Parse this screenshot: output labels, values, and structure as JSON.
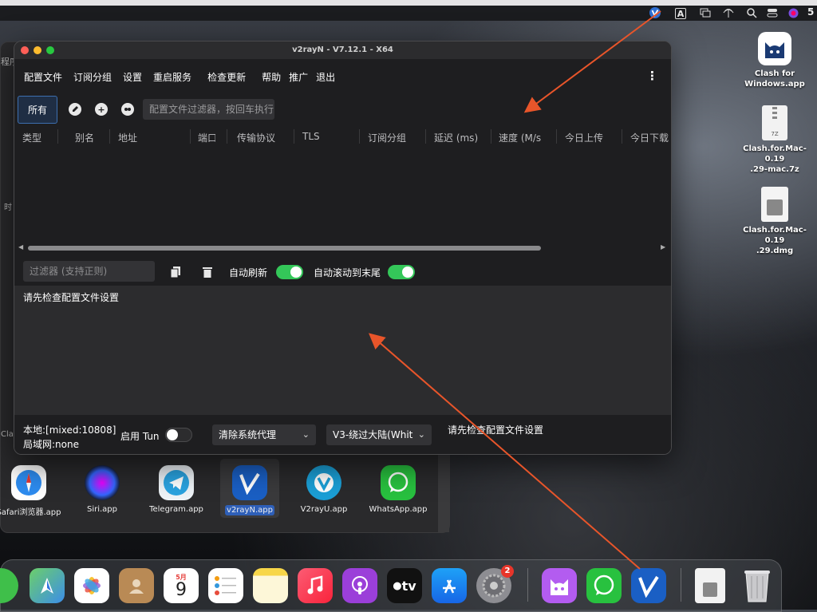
{
  "menubar": {
    "right_text": "5",
    "icons": [
      "v2ray-status-icon",
      "input-a-icon",
      "window-icon",
      "antenna-icon",
      "search-icon",
      "control-center-icon",
      "siri-icon"
    ]
  },
  "desktop": {
    "icons": [
      {
        "label": "Clash for\nWindows.app"
      },
      {
        "label": "Clash.for.Mac-0.19\n.29-mac.7z",
        "sub": "7Z"
      },
      {
        "label": "Clash.for.Mac-0.19\n.29.dmg"
      }
    ],
    "backwin_fragments": [
      "程序",
      "时",
      "Clas"
    ]
  },
  "window": {
    "title": "v2rayN - V7.12.1 - X64",
    "menu": [
      "配置文件",
      "订阅分组",
      "设置",
      "重启服务",
      "检查更新",
      "帮助",
      "推广",
      "退出"
    ],
    "more": "⋮",
    "tab_all": "所有",
    "filter_placeholder": "配置文件过滤器，按回车执行",
    "columns": [
      "类型",
      "别名",
      "地址",
      "端口",
      "传输协议",
      "TLS",
      "订阅分组",
      "延迟 (ms)",
      "速度 (M/s",
      "今日上传",
      "今日下载"
    ],
    "log_filter_placeholder": "过滤器 (支持正则)",
    "auto_refresh": "自动刷新",
    "auto_scroll": "自动滚动到末尾",
    "log_text": "请先检查配置文件设置",
    "status": {
      "local": "本地:[mixed:10808]",
      "lan": "局域网:none",
      "tun_label": "启用 Tun",
      "proxy_select": "清除系统代理",
      "routing_select": "V3-绕过大陆(Whit",
      "message": "请先检查配置文件设置"
    }
  },
  "apps": [
    {
      "label": "Safari浏览器.app"
    },
    {
      "label": "Siri.app"
    },
    {
      "label": "Telegram.app"
    },
    {
      "label": "v2rayN.app"
    },
    {
      "label": "V2rayU.app"
    },
    {
      "label": "WhatsApp.app"
    }
  ],
  "dock": {
    "calendar_month": "5月",
    "calendar_day": "9",
    "tv_label": "tv",
    "badge": "2"
  },
  "colors": {
    "accent_blue": "#3d6fb0",
    "toggle_green": "#34c759",
    "arrow_orange": "#e8552a"
  }
}
